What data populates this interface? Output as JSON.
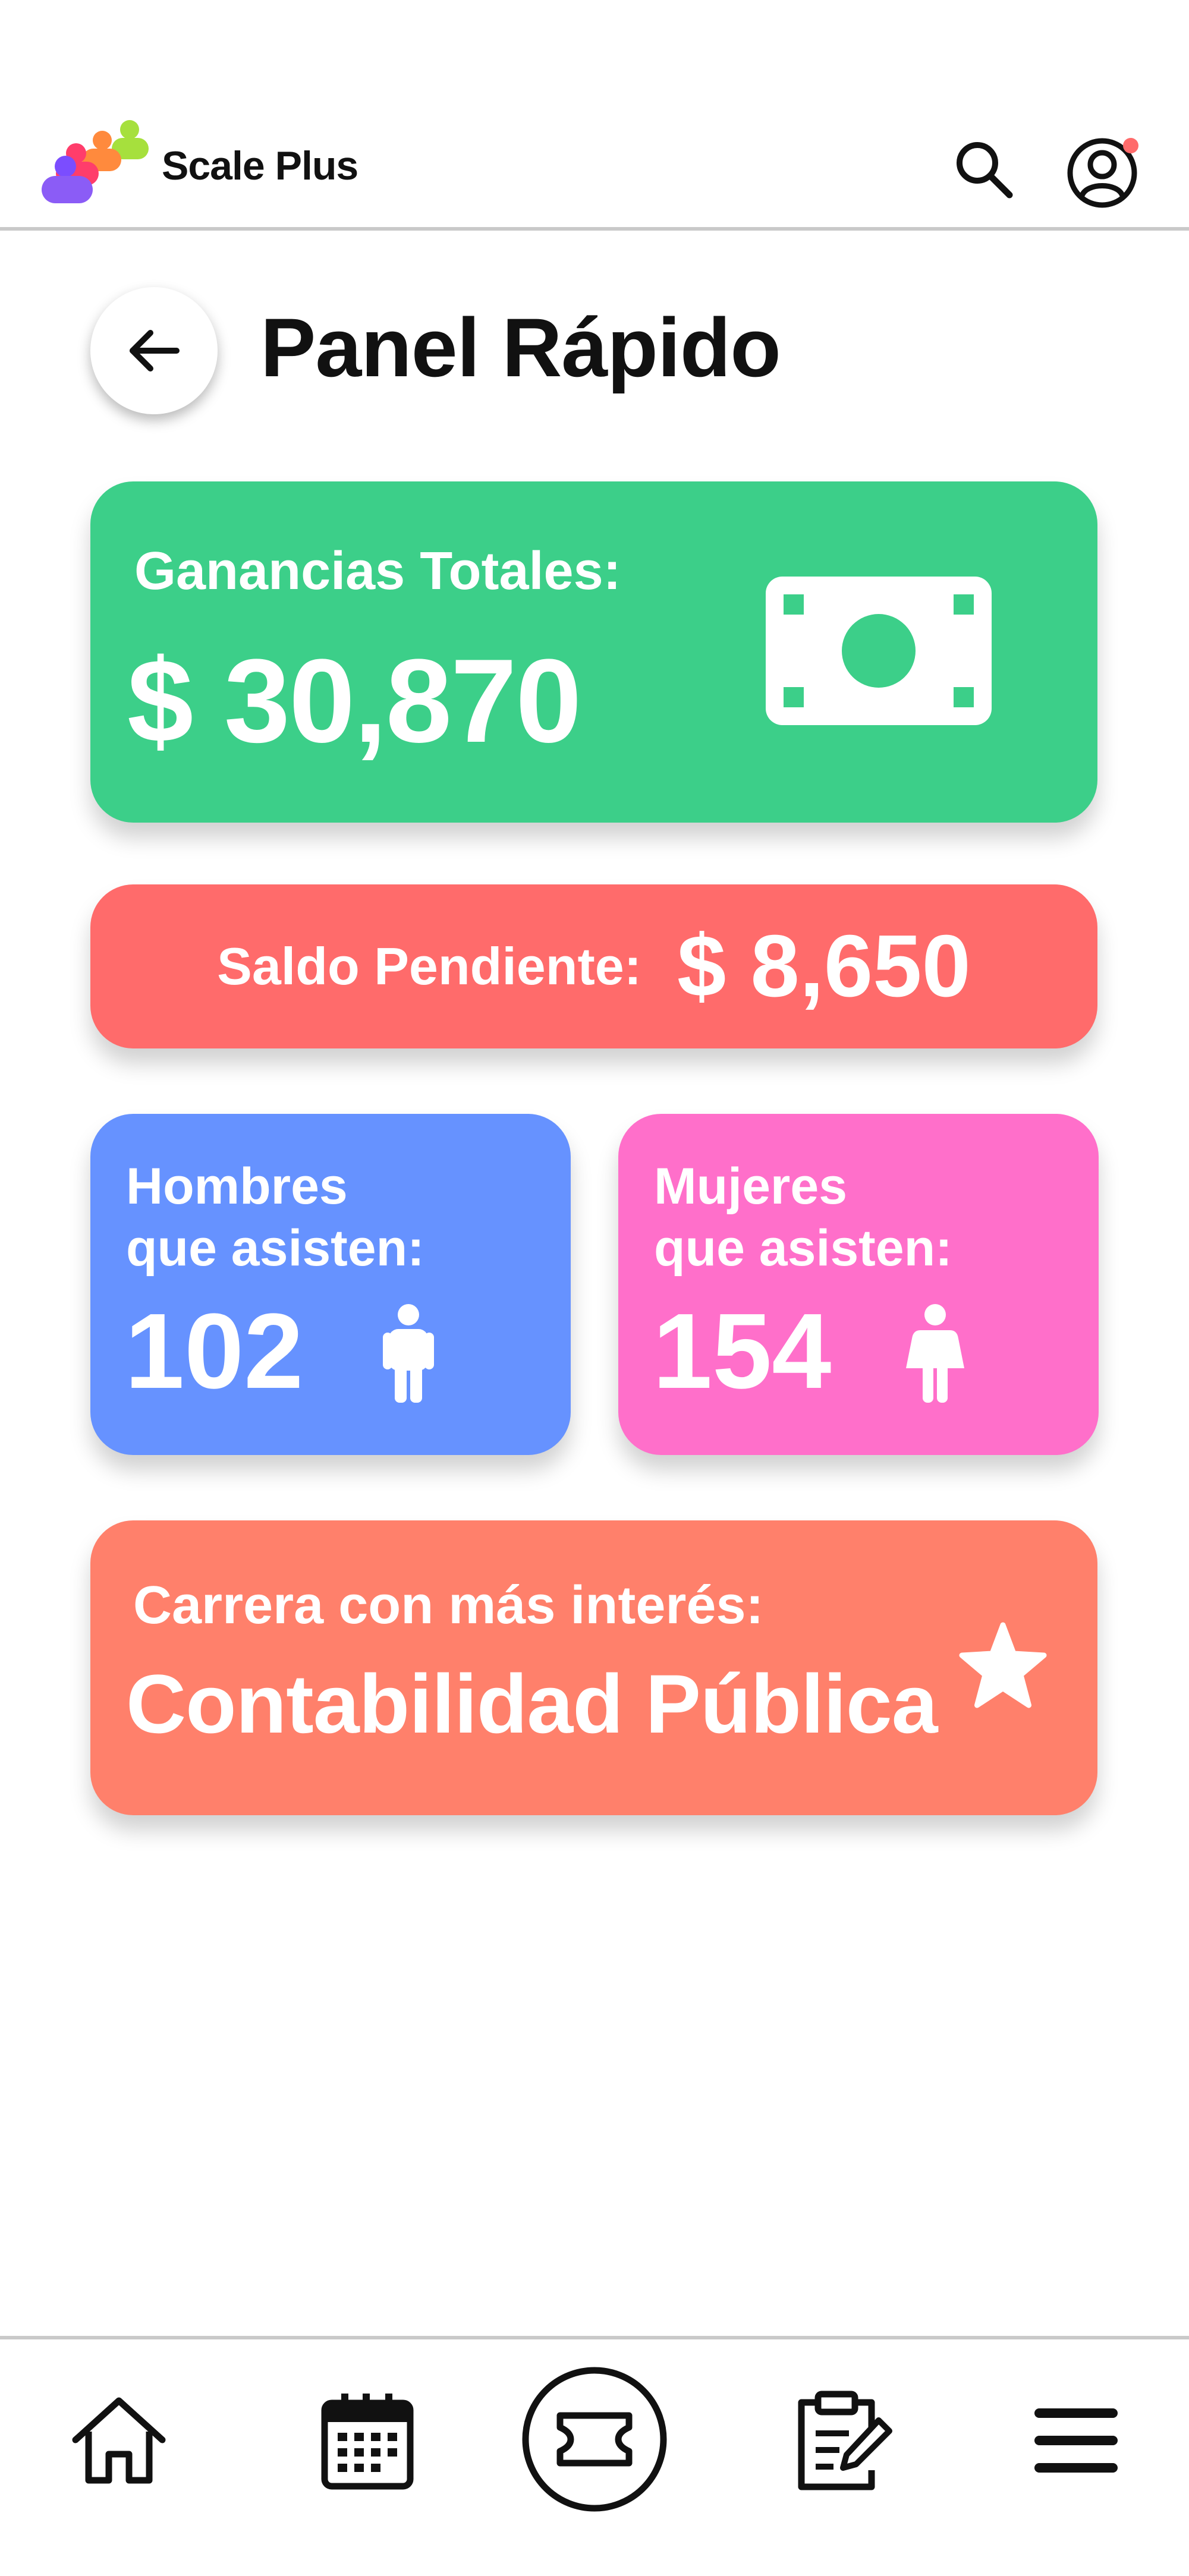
{
  "header": {
    "app_name": "Scale Plus",
    "logo_icon": "people-logo-icon",
    "search_icon": "search-icon",
    "profile_icon": "user-circle-icon",
    "notification_dot_color": "#ff6b6b"
  },
  "page": {
    "back_icon": "arrow-left-icon",
    "title": "Panel Rápido"
  },
  "earnings": {
    "label": "Ganancias Totales:",
    "value": "$ 30,870",
    "icon": "money-bill-icon",
    "color": "#3ccf89"
  },
  "balance": {
    "label": "Saldo Pendiente:",
    "value": "$ 8,650",
    "color": "#ff6b6b"
  },
  "men": {
    "label_line1": "Hombres",
    "label_line2": "que asisten:",
    "value": "102",
    "icon": "male-icon",
    "color": "#6692ff"
  },
  "women": {
    "label_line1": "Mujeres",
    "label_line2": "que asisten:",
    "value": "154",
    "icon": "female-icon",
    "color": "#ff6fca"
  },
  "career": {
    "label": "Carrera con más interés:",
    "value": "Contabilidad Pública",
    "icon": "star-icon",
    "color": "#ff806b"
  },
  "bottom_nav": {
    "items": [
      {
        "icon": "home-icon"
      },
      {
        "icon": "calendar-icon"
      },
      {
        "icon": "ticket-icon"
      },
      {
        "icon": "clipboard-edit-icon"
      },
      {
        "icon": "menu-icon"
      }
    ]
  }
}
